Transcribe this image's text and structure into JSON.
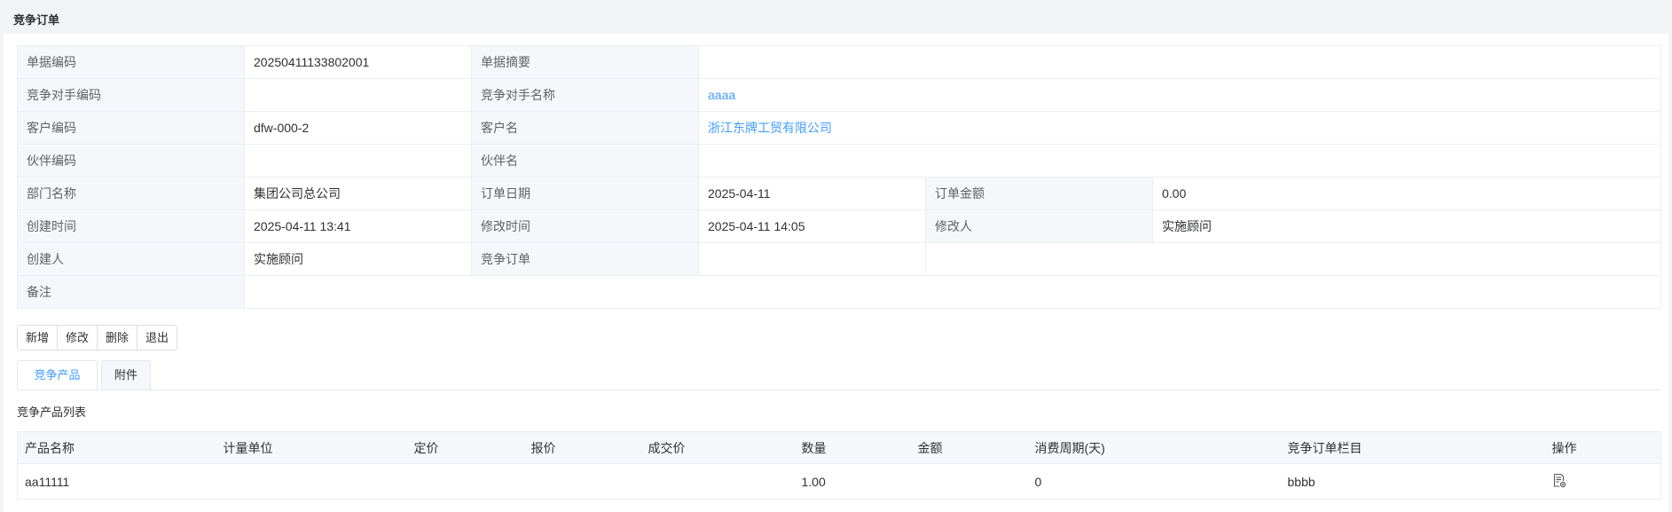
{
  "header": {
    "title": "竞争订单"
  },
  "form": {
    "bill_code": {
      "label": "单据编码",
      "value": "20250411133802001"
    },
    "bill_summary": {
      "label": "单据摘要",
      "value": ""
    },
    "competitor_code": {
      "label": "竞争对手编码",
      "value": ""
    },
    "competitor_name": {
      "label": "竞争对手名称",
      "value": "aaaa"
    },
    "customer_code": {
      "label": "客户编码",
      "value": "dfw-000-2"
    },
    "customer_name": {
      "label": "客户名",
      "value": "浙江东牌工贸有限公司"
    },
    "partner_code": {
      "label": "伙伴编码",
      "value": ""
    },
    "partner_name": {
      "label": "伙伴名",
      "value": ""
    },
    "dept_name": {
      "label": "部门名称",
      "value": "集团公司总公司"
    },
    "order_date": {
      "label": "订单日期",
      "value": "2025-04-11"
    },
    "order_amount": {
      "label": "订单金额",
      "value": "0.00"
    },
    "created_time": {
      "label": "创建时间",
      "value": "2025-04-11 13:41"
    },
    "modified_time": {
      "label": "修改时间",
      "value": "2025-04-11 14:05"
    },
    "modifier": {
      "label": "修改人",
      "value": "实施顾问"
    },
    "creator": {
      "label": "创建人",
      "value": "实施顾问"
    },
    "competitive_order": {
      "label": "竞争订单",
      "value": ""
    },
    "remark": {
      "label": "备注",
      "value": ""
    }
  },
  "toolbar": {
    "add": "新增",
    "edit": "修改",
    "delete": "删除",
    "exit": "退出"
  },
  "tabs": [
    {
      "label": "竞争产品",
      "active": true
    },
    {
      "label": "附件",
      "active": false
    }
  ],
  "list": {
    "title": "竞争产品列表",
    "columns": [
      "产品名称",
      "计量单位",
      "定价",
      "报价",
      "成交价",
      "数量",
      "金额",
      "消费周期(天)",
      "竞争订单栏目",
      "操作"
    ],
    "rows": [
      {
        "product_name": "aa11111",
        "unit": "",
        "list_price": "",
        "quote": "",
        "deal_price": "",
        "quantity": "1.00",
        "amount": "",
        "cycle": "0",
        "column": "bbbb",
        "action_icon": "document-edit-icon"
      }
    ]
  },
  "colors": {
    "link": "#409eff",
    "label_bg": "#f5f7fa",
    "border": "#ebeef5"
  }
}
